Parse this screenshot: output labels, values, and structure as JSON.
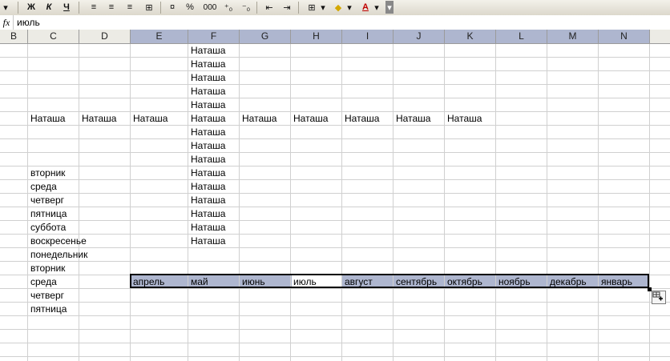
{
  "toolbar": {
    "bold": "Ж",
    "italic": "К",
    "underline": "Ч",
    "percent": "%",
    "thousands": "000",
    "font_color_letter": "А"
  },
  "formula_bar": {
    "fx": "fx",
    "value": "июль"
  },
  "columns": [
    "B",
    "C",
    "D",
    "E",
    "F",
    "G",
    "H",
    "I",
    "J",
    "K",
    "L",
    "M",
    "N"
  ],
  "selected_columns": [
    "E",
    "F",
    "G",
    "H",
    "I",
    "J",
    "K",
    "L",
    "M",
    "N"
  ],
  "cells": {
    "F1": "Наташа",
    "F2": "Наташа",
    "F3": "Наташа",
    "F4": "Наташа",
    "F5": "Наташа",
    "C6": "Наташа",
    "D6": "Наташа",
    "E6": "Наташа",
    "F6": "Наташа",
    "G6": "Наташа",
    "H6": "Наташа",
    "I6": "Наташа",
    "J6": "Наташа",
    "K6": "Наташа",
    "F7": "Наташа",
    "F8": "Наташа",
    "F9": "Наташа",
    "C10": "вторник",
    "F10": "Наташа",
    "C11": "среда",
    "F11": "Наташа",
    "C12": "четверг",
    "F12": "Наташа",
    "C13": "пятница",
    "F13": "Наташа",
    "C14": "суббота",
    "F14": "Наташа",
    "C15": "воскресенье",
    "F15": "Наташа",
    "C16": "понедельник",
    "C17": "вторник",
    "C18": "среда",
    "E18": "апрель",
    "F18": "май",
    "G18": "июнь",
    "H18": "июль",
    "I18": "август",
    "J18": "сентябрь",
    "K18": "октябрь",
    "L18": "ноябрь",
    "M18": "декабрь",
    "N18": "январь",
    "C19": "четверг",
    "C20": "пятница"
  },
  "selection": {
    "range": "E18:N18",
    "active_cell": "H18"
  }
}
